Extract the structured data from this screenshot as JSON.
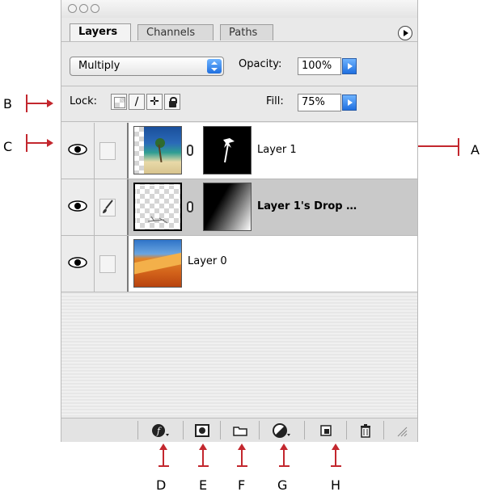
{
  "window": {
    "tabs": [
      {
        "label": "Layers",
        "active": true
      },
      {
        "label": "Channels",
        "active": false
      },
      {
        "label": "Paths",
        "active": false
      }
    ]
  },
  "options": {
    "blend_mode": "Multiply",
    "opacity_label": "Opacity:",
    "opacity_value": "100%",
    "lock_label": "Lock:",
    "fill_label": "Fill:",
    "fill_value": "75%"
  },
  "layers": [
    {
      "name": "Layer 1",
      "bold": false,
      "visible": true,
      "selected": false
    },
    {
      "name": "Layer 1's Drop …",
      "bold": true,
      "visible": true,
      "selected": true
    },
    {
      "name": "Layer 0",
      "bold": false,
      "visible": true,
      "selected": false
    }
  ],
  "bottom_buttons": [
    {
      "icon": "layer-style-icon"
    },
    {
      "icon": "add-mask-icon"
    },
    {
      "icon": "new-set-icon"
    },
    {
      "icon": "adjustment-layer-icon"
    },
    {
      "icon": "new-layer-icon"
    },
    {
      "icon": "trash-icon"
    }
  ],
  "callouts": {
    "A": "A",
    "B": "B",
    "C": "C",
    "D": "D",
    "E": "E",
    "F": "F",
    "G": "G",
    "H": "H"
  },
  "colors": {
    "callout_red": "#c3272e",
    "accent_blue": "#1f6fe0",
    "selected_row": "#c9c9c9"
  }
}
